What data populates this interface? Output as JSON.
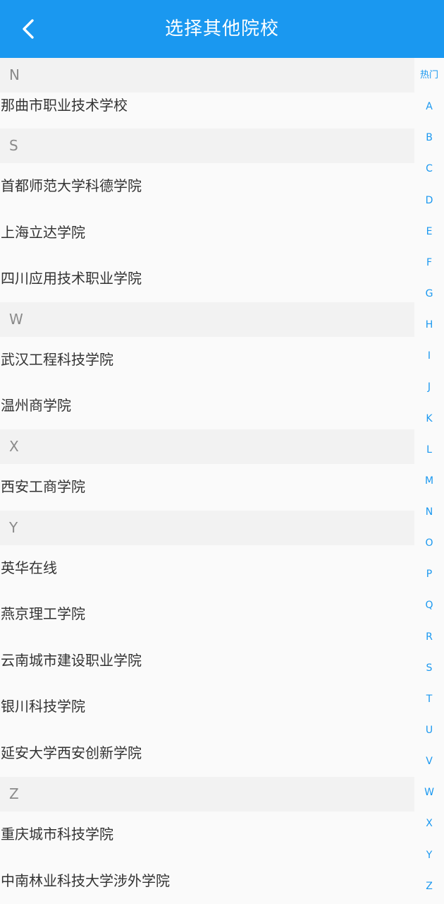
{
  "header": {
    "title": "选择其他院校"
  },
  "sections": [
    {
      "letter": "N",
      "items": [
        "那曲市职业技术学校"
      ]
    },
    {
      "letter": "S",
      "items": [
        "首都师范大学科德学院",
        "上海立达学院",
        "四川应用技术职业学院"
      ]
    },
    {
      "letter": "W",
      "items": [
        "武汉工程科技学院",
        "温州商学院"
      ]
    },
    {
      "letter": "X",
      "items": [
        "西安工商学院"
      ]
    },
    {
      "letter": "Y",
      "items": [
        "英华在线",
        "燕京理工学院",
        "云南城市建设职业学院",
        "银川科技学院",
        "延安大学西安创新学院"
      ]
    },
    {
      "letter": "Z",
      "items": [
        "重庆城市科技学院",
        "中南林业科技大学涉外学院"
      ]
    }
  ],
  "index_bar": [
    "热门",
    "A",
    "B",
    "C",
    "D",
    "E",
    "F",
    "G",
    "H",
    "I",
    "J",
    "K",
    "L",
    "M",
    "N",
    "O",
    "P",
    "Q",
    "R",
    "S",
    "T",
    "U",
    "V",
    "W",
    "X",
    "Y",
    "Z"
  ],
  "colors": {
    "accent": "#1a98f0",
    "section_bg": "#f2f2f2",
    "item_text": "#333333"
  }
}
